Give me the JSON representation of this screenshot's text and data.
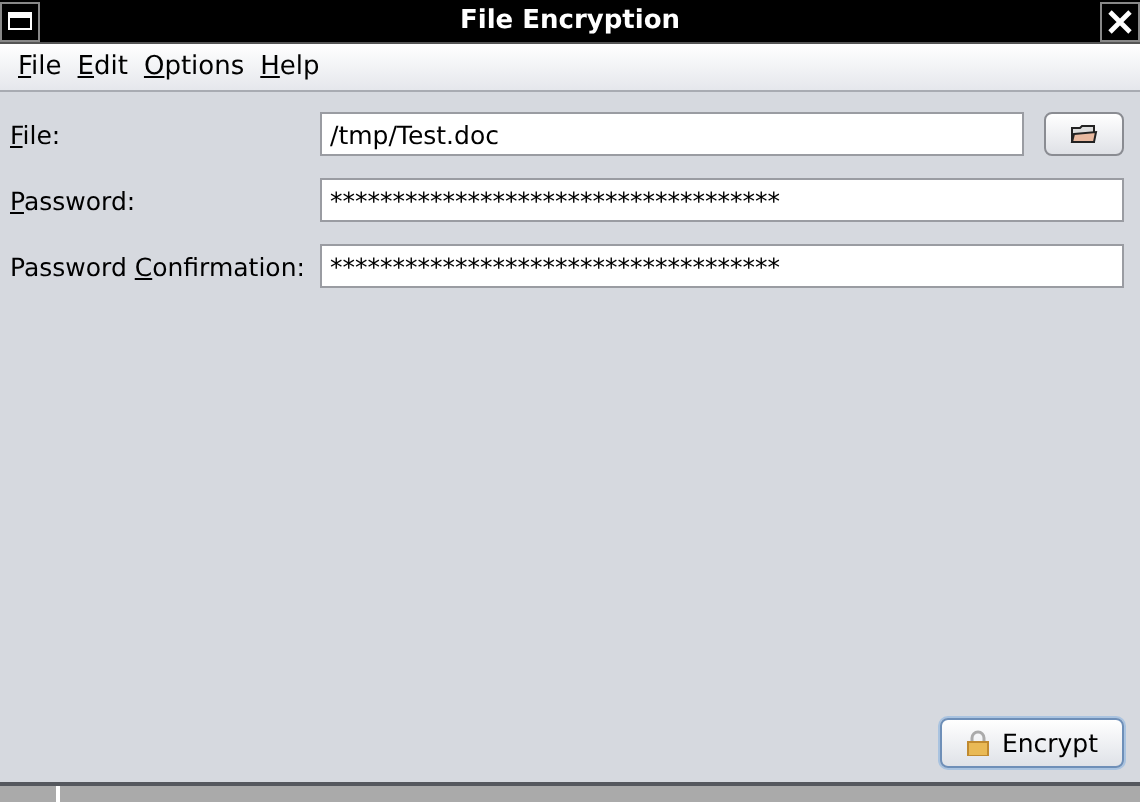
{
  "window": {
    "title": "File Encryption"
  },
  "menu": [
    {
      "mnemonic": "F",
      "label_rest": "ile"
    },
    {
      "mnemonic": "E",
      "label_rest": "dit"
    },
    {
      "mnemonic": "O",
      "label_rest": "ptions"
    },
    {
      "mnemonic": "H",
      "label_rest": "elp"
    }
  ],
  "fields": [
    {
      "kind": "file",
      "mnemonic": "F",
      "label_rest": "ile:",
      "value": "/tmp/Test.doc"
    },
    {
      "kind": "password",
      "mnemonic": "P",
      "label_rest": "assword:",
      "value": "************************************"
    },
    {
      "kind": "password",
      "label_start": "Password ",
      "mnemonic": "C",
      "label_rest": "onfirmation:",
      "value": "************************************"
    }
  ],
  "encrypt_button": {
    "label": "Encrypt"
  }
}
